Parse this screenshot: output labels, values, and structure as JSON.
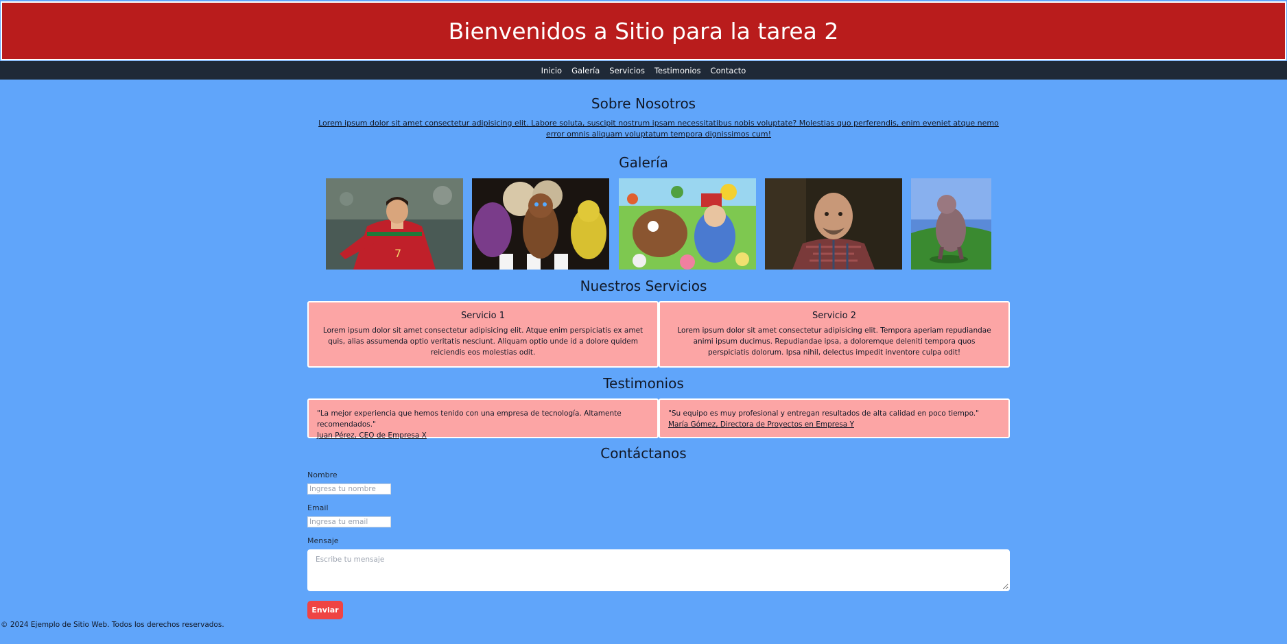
{
  "header": {
    "title": "Bienvenidos a Sitio para la tarea 2"
  },
  "nav": {
    "items": [
      "Inicio",
      "Galería",
      "Servicios",
      "Testimonios",
      "Contacto"
    ]
  },
  "about": {
    "title": "Sobre Nosotros",
    "text": "Lorem ipsum dolor sit amet consectetur adipisicing elit. Labore soluta, suscipit nostrum ipsam necessitatibus nobis voluptate? Molestias quo perferendis, enim eveniet atque nemo error omnis aliquam voluptatum tempora dignissimos cum!"
  },
  "gallery": {
    "title": "Galería",
    "images": [
      "soccer-player-photo",
      "animatronic-characters-image",
      "cartoon-crowd-drawing",
      "bald-man-portrait",
      "creature-on-grass-image"
    ]
  },
  "services": {
    "title": "Nuestros Servicios",
    "items": [
      {
        "title": "Servicio 1",
        "text": "Lorem ipsum dolor sit amet consectetur adipisicing elit. Atque enim perspiciatis ex amet quis, alias assumenda optio veritatis nesciunt. Aliquam optio unde id a dolore quidem reiciendis eos molestias odit."
      },
      {
        "title": "Servicio 2",
        "text": "Lorem ipsum dolor sit amet consectetur adipisicing elit. Tempora aperiam repudiandae animi ipsum ducimus. Repudiandae ipsa, a doloremque deleniti tempora quos perspiciatis dolorum. Ipsa nihil, delectus impedit inventore culpa odit!"
      }
    ]
  },
  "testimonials": {
    "title": "Testimonios",
    "items": [
      {
        "quote": "\"La mejor experiencia que hemos tenido con una empresa de tecnología. Altamente recomendados.\"",
        "author": "Juan Pérez, CEO de Empresa X"
      },
      {
        "quote": "\"Su equipo es muy profesional y entregan resultados de alta calidad en poco tiempo.\"",
        "author": "María Gómez, Directora de Proyectos en Empresa Y"
      }
    ]
  },
  "contact": {
    "title": "Contáctanos",
    "name_label": "Nombre",
    "name_placeholder": "Ingresa tu nombre",
    "email_label": "Email",
    "email_placeholder": "Ingresa tu email",
    "message_label": "Mensaje",
    "message_placeholder": "Escribe tu mensaje",
    "submit_label": "Enviar"
  },
  "footer": {
    "text": "© 2024 Ejemplo de Sitio Web. Todos los derechos reservados."
  },
  "colors": {
    "header_bg": "#b91c1c",
    "nav_bg": "#1f2937",
    "page_bg": "#60a5fa",
    "card_bg": "#fca5a5",
    "button_bg": "#ef4444"
  }
}
